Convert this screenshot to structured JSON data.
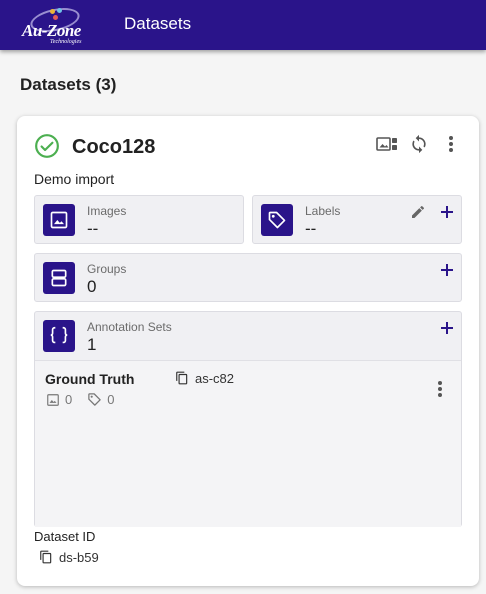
{
  "header": {
    "logo_text": "Au-Zone",
    "logo_tagline": "Technologies",
    "title": "Datasets",
    "background": "#2a148a"
  },
  "page": {
    "heading": "Datasets (3)"
  },
  "dataset": {
    "status_icon": "check-circle-icon",
    "status_color": "#4caf50",
    "name": "Coco128",
    "description": "Demo import",
    "header_actions": [
      "gallery-icon",
      "sync-icon",
      "more-vert-icon"
    ],
    "tiles": {
      "images": {
        "label": "Images",
        "value": "--",
        "icon": "image-icon"
      },
      "labels": {
        "label": "Labels",
        "value": "--",
        "icon": "label-tag-icon",
        "actions": [
          "edit-icon",
          "add-icon"
        ]
      },
      "groups": {
        "label": "Groups",
        "value": "0",
        "icon": "groups-icon",
        "actions": [
          "add-icon"
        ]
      },
      "annotation_sets": {
        "label": "Annotation Sets",
        "value": "1",
        "icon": "braces-icon",
        "actions": [
          "add-icon"
        ],
        "items": [
          {
            "name": "Ground Truth",
            "id": "as-c82",
            "image_count": "0",
            "label_count": "0"
          }
        ]
      }
    },
    "id_label": "Dataset ID",
    "id": "ds-b59"
  }
}
